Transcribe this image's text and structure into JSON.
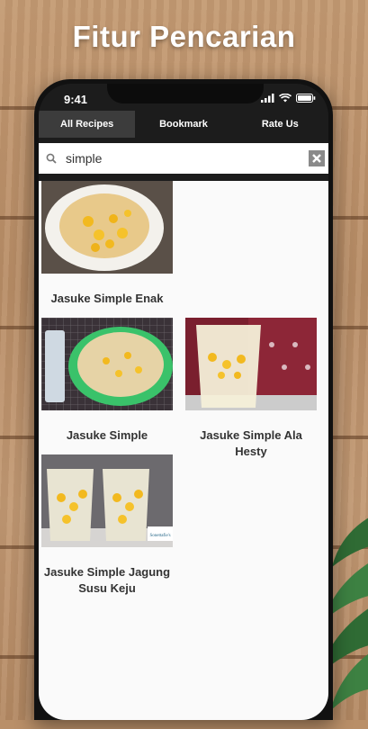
{
  "hero": {
    "title": "Fitur Pencarian"
  },
  "status_bar": {
    "time": "9:41"
  },
  "tabs": [
    {
      "label": "All Recipes",
      "active": true
    },
    {
      "label": "Bookmark",
      "active": false
    },
    {
      "label": "Rate Us",
      "active": false
    }
  ],
  "search": {
    "value": "simple"
  },
  "results": [
    {
      "title": "Jasuke Simple Enak",
      "image": "corn-cheese-bowl"
    },
    {
      "title": "Jasuke Simple",
      "image": "corn-cheese-green-bowl"
    },
    {
      "title": "Jasuke Simple Ala Hesty",
      "image": "corn-cheese-glass"
    },
    {
      "title": "Jasuke Simple Jagung Susu Keju",
      "image": "corn-milk-glasses",
      "watermark": "Sonettafie's"
    }
  ],
  "colors": {
    "accent": "#1c1c1c",
    "tab_active": "#3c3c3c",
    "background_wood": "#b98f68"
  }
}
